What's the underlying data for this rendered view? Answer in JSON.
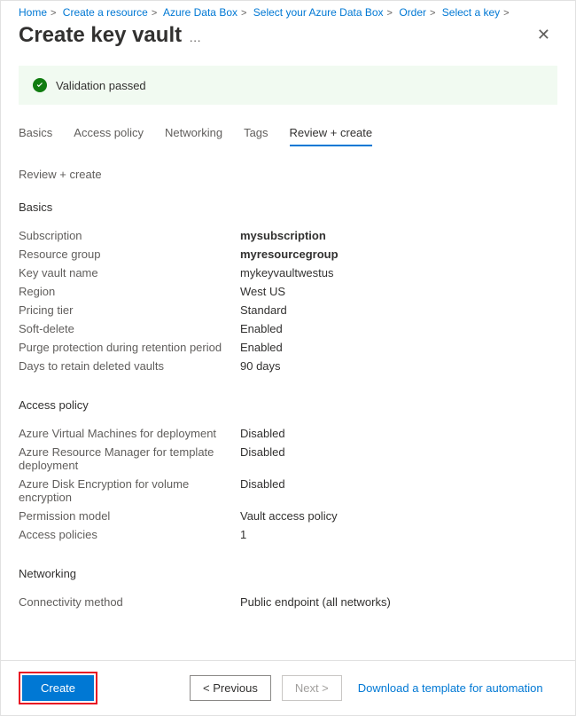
{
  "breadcrumbs": [
    {
      "label": "Home"
    },
    {
      "label": "Create a resource"
    },
    {
      "label": "Azure Data Box"
    },
    {
      "label": "Select your Azure Data Box"
    },
    {
      "label": "Order"
    },
    {
      "label": "Select a key"
    }
  ],
  "header": {
    "title": "Create key vault",
    "more": "…"
  },
  "validation": {
    "text": "Validation passed"
  },
  "tabs": [
    {
      "label": "Basics"
    },
    {
      "label": "Access policy"
    },
    {
      "label": "Networking"
    },
    {
      "label": "Tags"
    },
    {
      "label": "Review + create"
    }
  ],
  "activeTabIndex": 4,
  "subheading": "Review + create",
  "sections": {
    "basics": {
      "title": "Basics",
      "rows": [
        {
          "label": "Subscription",
          "value": "mysubscription",
          "bold": true
        },
        {
          "label": "Resource group",
          "value": "myresourcegroup",
          "bold": true
        },
        {
          "label": "Key vault name",
          "value": "mykeyvaultwestus"
        },
        {
          "label": "Region",
          "value": "West US"
        },
        {
          "label": "Pricing tier",
          "value": "Standard"
        },
        {
          "label": "Soft-delete",
          "value": "Enabled"
        },
        {
          "label": "Purge protection during retention period",
          "value": "Enabled"
        },
        {
          "label": "Days to retain deleted vaults",
          "value": "90 days"
        }
      ]
    },
    "accessPolicy": {
      "title": "Access policy",
      "rows": [
        {
          "label": "Azure Virtual Machines for deployment",
          "value": "Disabled"
        },
        {
          "label": "Azure Resource Manager for template deployment",
          "value": "Disabled"
        },
        {
          "label": "Azure Disk Encryption for volume encryption",
          "value": "Disabled"
        },
        {
          "label": "Permission model",
          "value": "Vault access policy"
        },
        {
          "label": "Access policies",
          "value": "1"
        }
      ]
    },
    "networking": {
      "title": "Networking",
      "rows": [
        {
          "label": "Connectivity method",
          "value": "Public endpoint (all networks)"
        }
      ]
    }
  },
  "footer": {
    "create": "Create",
    "previous": "< Previous",
    "next": "Next >",
    "download": "Download a template for automation"
  }
}
